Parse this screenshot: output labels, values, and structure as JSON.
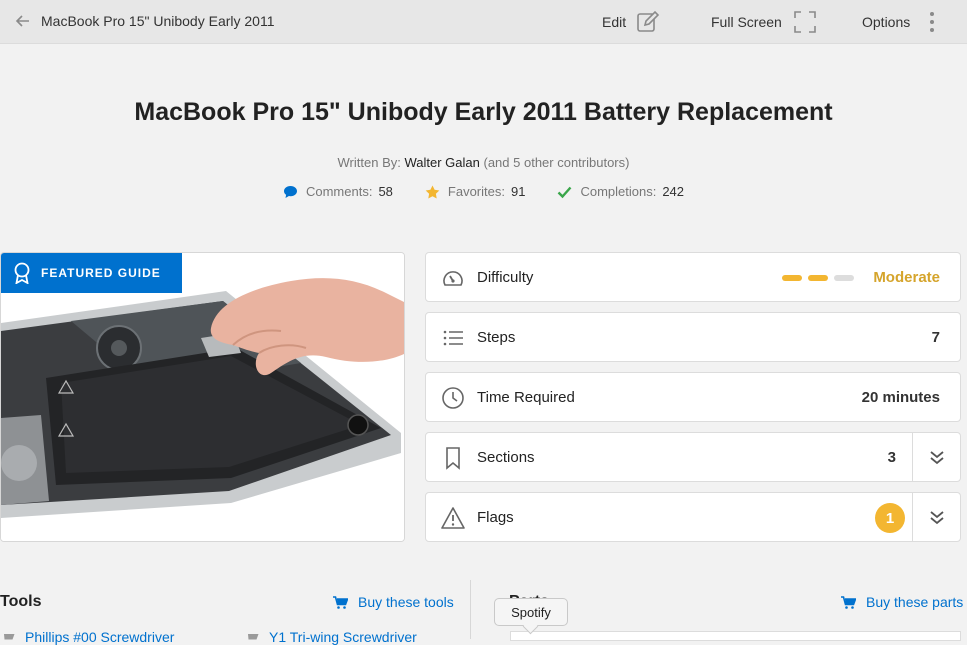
{
  "topbar": {
    "breadcrumb": "MacBook Pro 15\" Unibody Early 2011",
    "edit_label": "Edit",
    "fullscreen_label": "Full Screen",
    "options_label": "Options"
  },
  "guide": {
    "title": "MacBook Pro 15\" Unibody Early 2011 Battery Replacement",
    "written_by_label": "Written By:",
    "author": "Walter Galan",
    "contributors": "(and 5 other contributors)",
    "stats": {
      "comments_label": "Comments:",
      "comments": "58",
      "favorites_label": "Favorites:",
      "favorites": "91",
      "completions_label": "Completions:",
      "completions": "242"
    },
    "featured_badge": "FEATURED GUIDE"
  },
  "details": {
    "difficulty_label": "Difficulty",
    "difficulty_value": "Moderate",
    "difficulty_level": 2,
    "difficulty_max": 3,
    "steps_label": "Steps",
    "steps_value": "7",
    "time_label": "Time Required",
    "time_value": "20 minutes",
    "sections_label": "Sections",
    "sections_value": "3",
    "flags_label": "Flags",
    "flags_value": "1"
  },
  "tools": {
    "heading": "Tools",
    "buy_label": "Buy these tools",
    "items": [
      "Phillips #00 Screwdriver",
      "Y1 Tri-wing Screwdriver"
    ]
  },
  "parts": {
    "heading": "Parts",
    "buy_label": "Buy these parts"
  },
  "tooltip": "Spotify",
  "colors": {
    "accent": "#0071ce",
    "moderate": "#d5a42b",
    "flag": "#f3b631",
    "check": "#3aa64a",
    "star": "#f3b631"
  }
}
